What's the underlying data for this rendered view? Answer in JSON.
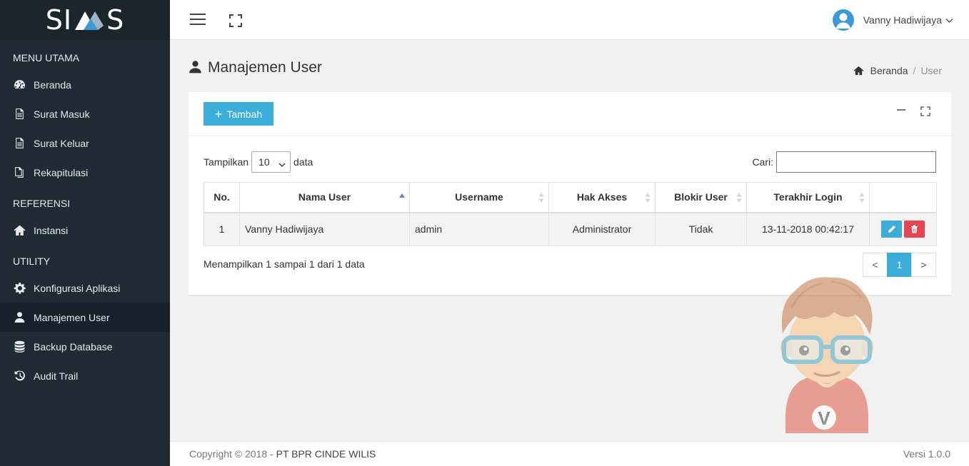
{
  "brand": {
    "left": "SI",
    "right": "S"
  },
  "sidebar": {
    "sections": [
      {
        "header": "MENU UTAMA"
      },
      {
        "header": "REFERENSI"
      },
      {
        "header": "UTILITY"
      }
    ],
    "items": [
      {
        "label": "Beranda",
        "icon": "dashboard-icon"
      },
      {
        "label": "Surat Masuk",
        "icon": "document-icon"
      },
      {
        "label": "Surat Keluar",
        "icon": "document-icon"
      },
      {
        "label": "Rekapitulasi",
        "icon": "copy-icon"
      },
      {
        "label": "Instansi",
        "icon": "home-icon"
      },
      {
        "label": "Konfigurasi Aplikasi",
        "icon": "gear-icon"
      },
      {
        "label": "Manajemen User",
        "icon": "user-icon",
        "active": true
      },
      {
        "label": "Backup Database",
        "icon": "database-icon"
      },
      {
        "label": "Audit Trail",
        "icon": "history-icon"
      }
    ]
  },
  "topbar": {
    "user_name": "Vanny Hadiwijaya"
  },
  "page": {
    "title": "Manajemen User"
  },
  "breadcrumb": {
    "home": "Beranda",
    "sep": "/",
    "current": "User"
  },
  "toolbar": {
    "add_label": "Tambah",
    "add_icon": "+"
  },
  "table_controls": {
    "show_label": "Tampilkan",
    "page_size": "10",
    "data_label": "data",
    "search_label": "Cari:",
    "search_value": ""
  },
  "table": {
    "columns": [
      "No.",
      "Nama User",
      "Username",
      "Hak Akses",
      "Blokir User",
      "Terakhir Login"
    ],
    "rows": [
      {
        "no": "1",
        "name": "Vanny Hadiwijaya",
        "username": "admin",
        "role": "Administrator",
        "blocked": "Tidak",
        "last_login": "13-11-2018 00:42:17"
      }
    ]
  },
  "table_info": "Menampilkan 1 sampai 1 dari 1 data",
  "pagination": {
    "prev": "<",
    "current": "1",
    "next": ">"
  },
  "footer": {
    "copyright": "Copyright © 2018 - ",
    "company": "PT BPR CINDE WILIS",
    "version": "Versi 1.0.0"
  },
  "mascot": {
    "letter": "V"
  },
  "colors": {
    "sidebar_bg": "#1f2b33",
    "accent": "#3aaed8",
    "danger": "#e54554"
  }
}
